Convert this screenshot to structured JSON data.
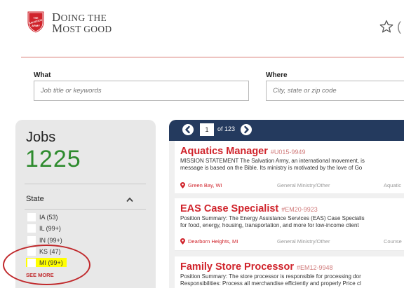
{
  "header": {
    "logo_line1_big": "D",
    "logo_line1_rest": "OING THE",
    "logo_line2_big": "M",
    "logo_line2_rest": "OST GOOD",
    "shield_text": "THE SALVATION ARMY",
    "edge_glyph": "("
  },
  "search": {
    "what_label": "What",
    "what_placeholder": "Job title or keywords",
    "where_label": "Where",
    "where_placeholder": "City, state or zip code"
  },
  "sidebar": {
    "jobs_label": "Jobs",
    "jobs_count": "1225",
    "state_label": "State",
    "states": [
      {
        "label": "IA (53)"
      },
      {
        "label": "IL (99+)"
      },
      {
        "label": "IN (99+)"
      },
      {
        "label": "KS (47)"
      },
      {
        "label": "MI (99+)"
      }
    ],
    "see_more": "SEE MORE"
  },
  "pager": {
    "current_page": "1",
    "of_text": "of 123"
  },
  "jobs": [
    {
      "title": "Aquatics Manager",
      "code": "#U015-9949",
      "desc_line1": "MISSION STATEMENT The Salvation Army, an international movement, is",
      "desc_line2": "message is based on the Bible. Its ministry is motivated by the love of Go",
      "location": "Green Bay, WI",
      "category": "General Ministry/Other",
      "extra": "Aquatic"
    },
    {
      "title": "EAS Case Specialist",
      "code": "#EM20-9923",
      "desc_line1": "Position Summary:  The Energy Assistance Services (EAS) Case Specialis",
      "desc_line2": "for food, energy, housing, transportation, and more for low-income client",
      "location": "Dearborn Heights, MI",
      "category": "General Ministry/Other",
      "extra": "Counse"
    },
    {
      "title": "Family Store Processor",
      "code": "#EM12-9948",
      "desc_line1": "Position Summary: The store processor is responsible for processing dor",
      "desc_line2": "Responsibilities: Process all merchandise efficiently and properly Price cl"
    }
  ],
  "colors": {
    "brand_red": "#d0232b",
    "navy": "#243a5e",
    "count_green": "#2e8b2e",
    "highlight": "#ffff00"
  }
}
